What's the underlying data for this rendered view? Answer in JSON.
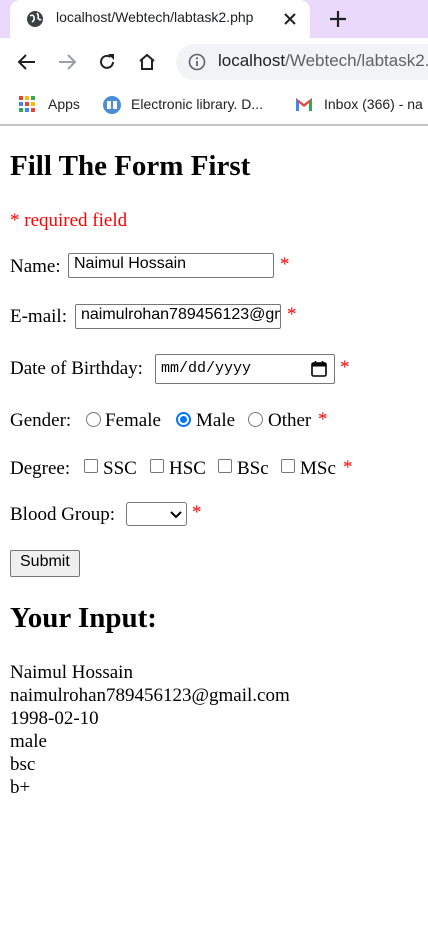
{
  "browser": {
    "tab_title": "localhost/Webtech/labtask2.php",
    "url_host": "localhost",
    "url_path": "/Webtech/labtask2.php",
    "bookmarks": [
      "Apps",
      "Electronic library. D...",
      "Inbox (366) - na"
    ]
  },
  "form": {
    "heading": "Fill The Form First",
    "required_note": "* required field",
    "asterisk": "*",
    "name_label": "Name:",
    "name_value": "Naimul Hossain",
    "email_label": "E-mail:",
    "email_value": "naimulrohan789456123@gmail.com",
    "dob_label": "Date of Birthday:",
    "dob_placeholder": "mm/dd/yyyy",
    "gender_label": "Gender:",
    "gender_options": [
      "Female",
      "Male",
      "Other"
    ],
    "gender_selected": "Male",
    "degree_label": "Degree:",
    "degree_options": [
      "SSC",
      "HSC",
      "BSc",
      "MSc"
    ],
    "blood_label": "Blood Group:",
    "blood_value": "",
    "submit_label": "Submit"
  },
  "output": {
    "heading": "Your Input:",
    "lines": [
      "Naimul Hossain",
      "naimulrohan789456123@gmail.com",
      "1998-02-10",
      "male",
      "bsc",
      "b+"
    ]
  },
  "colors": {
    "required": "#ff0000",
    "tabstrip": "#ead9fb",
    "radio_checked": "#0075ff"
  }
}
